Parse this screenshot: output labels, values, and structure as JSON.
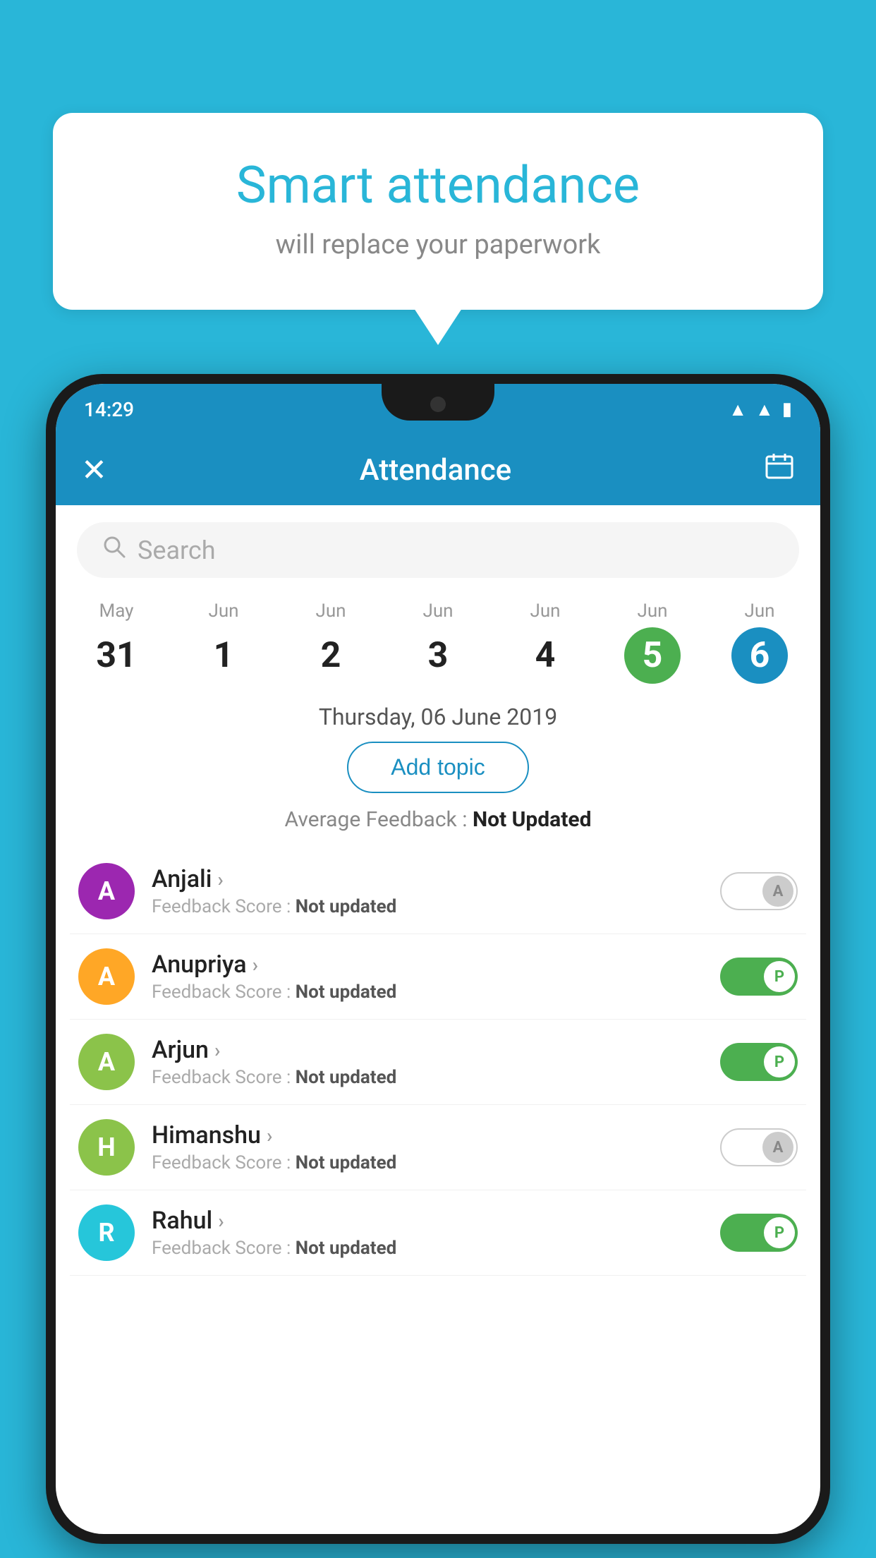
{
  "background_color": "#29b6d8",
  "bubble": {
    "title": "Smart attendance",
    "subtitle": "will replace your paperwork"
  },
  "status_bar": {
    "time": "14:29",
    "icons": [
      "wifi",
      "signal",
      "battery"
    ]
  },
  "toolbar": {
    "close_label": "✕",
    "title": "Attendance",
    "calendar_icon": "📅"
  },
  "search": {
    "placeholder": "Search"
  },
  "calendar": {
    "days": [
      {
        "month": "May",
        "date": "31",
        "style": "normal"
      },
      {
        "month": "Jun",
        "date": "1",
        "style": "normal"
      },
      {
        "month": "Jun",
        "date": "2",
        "style": "normal"
      },
      {
        "month": "Jun",
        "date": "3",
        "style": "normal"
      },
      {
        "month": "Jun",
        "date": "4",
        "style": "normal"
      },
      {
        "month": "Jun",
        "date": "5",
        "style": "today"
      },
      {
        "month": "Jun",
        "date": "6",
        "style": "selected"
      }
    ]
  },
  "selected_date_label": "Thursday, 06 June 2019",
  "add_topic_label": "Add topic",
  "avg_feedback_label": "Average Feedback :",
  "avg_feedback_value": "Not Updated",
  "students": [
    {
      "name": "Anjali",
      "initial": "A",
      "avatar_color": "#9c27b0",
      "feedback_label": "Feedback Score :",
      "feedback_value": "Not updated",
      "toggle": "off",
      "toggle_letter": "A"
    },
    {
      "name": "Anupriya",
      "initial": "A",
      "avatar_color": "#ffa726",
      "feedback_label": "Feedback Score :",
      "feedback_value": "Not updated",
      "toggle": "on",
      "toggle_letter": "P"
    },
    {
      "name": "Arjun",
      "initial": "A",
      "avatar_color": "#8bc34a",
      "feedback_label": "Feedback Score :",
      "feedback_value": "Not updated",
      "toggle": "on",
      "toggle_letter": "P"
    },
    {
      "name": "Himanshu",
      "initial": "H",
      "avatar_color": "#8bc34a",
      "feedback_label": "Feedback Score :",
      "feedback_value": "Not updated",
      "toggle": "off",
      "toggle_letter": "A"
    },
    {
      "name": "Rahul",
      "initial": "R",
      "avatar_color": "#26c6da",
      "feedback_label": "Feedback Score :",
      "feedback_value": "Not updated",
      "toggle": "on",
      "toggle_letter": "P"
    }
  ]
}
